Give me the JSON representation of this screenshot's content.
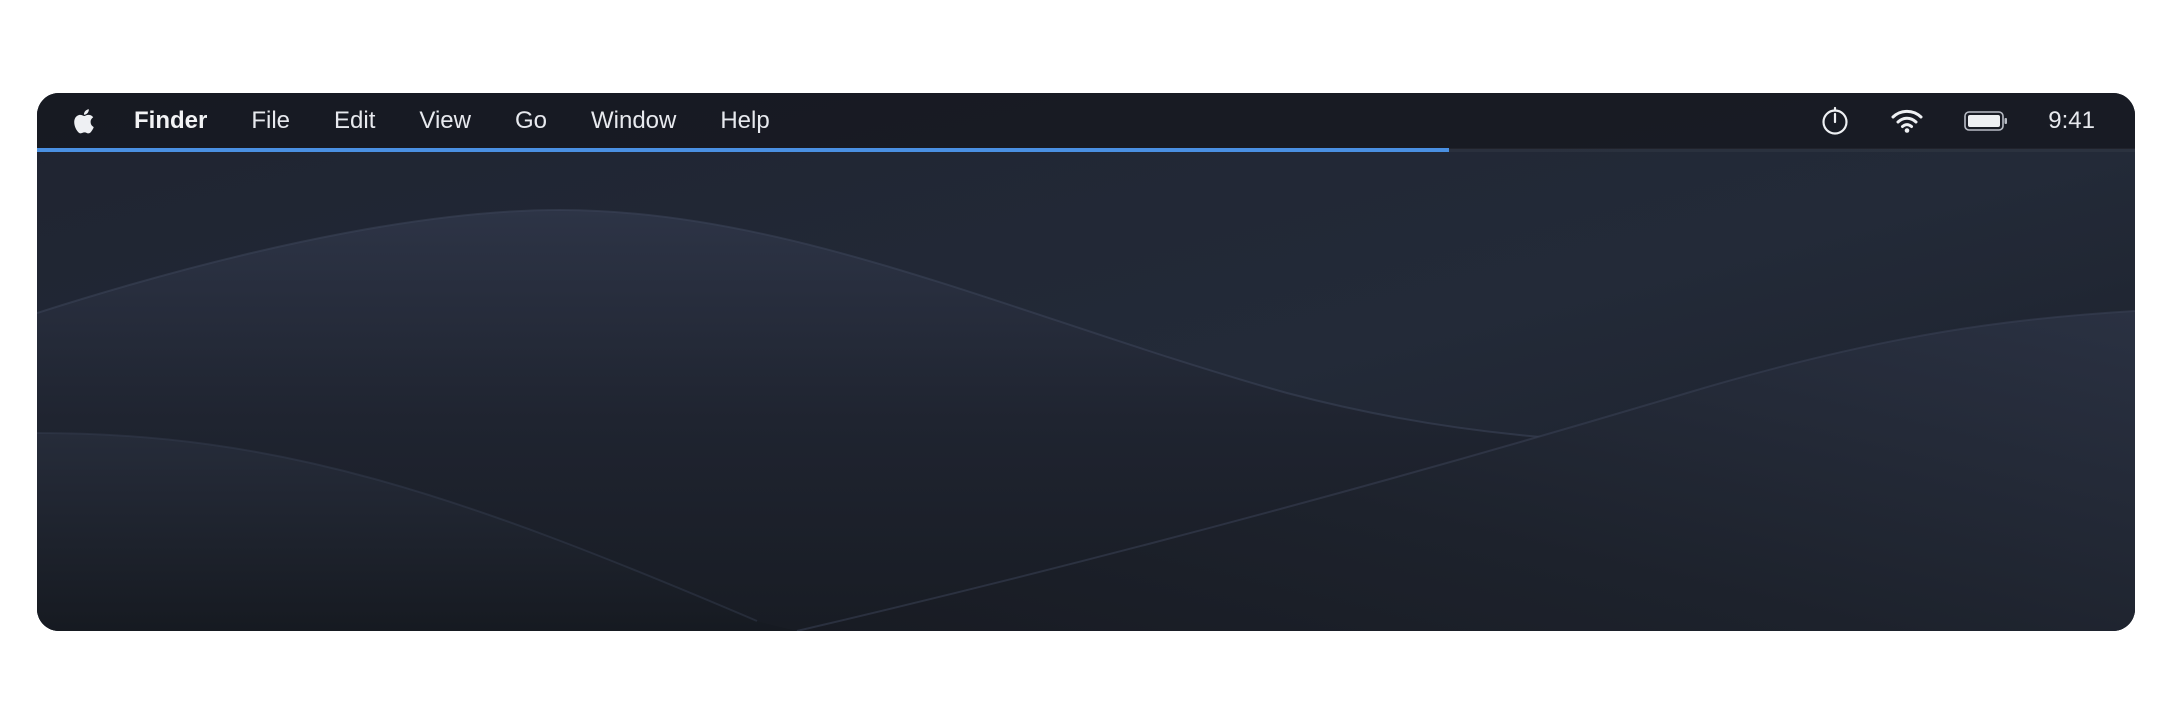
{
  "menubar": {
    "apple_icon": "apple-logo-icon",
    "items": [
      {
        "label": "Finder"
      },
      {
        "label": "File"
      },
      {
        "label": "Edit"
      },
      {
        "label": "View"
      },
      {
        "label": "Go"
      },
      {
        "label": "Window"
      },
      {
        "label": "Help"
      }
    ],
    "status": {
      "timer_icon": "timer-icon",
      "wifi_icon": "wifi-icon",
      "battery_icon": "battery-icon",
      "clock": "9:41"
    }
  },
  "loading_progress": {
    "fraction": 0.673,
    "color": "#4a90e2"
  },
  "wallpaper": {
    "base_color": "#1b1f28",
    "highlight_color": "#2c3445"
  }
}
